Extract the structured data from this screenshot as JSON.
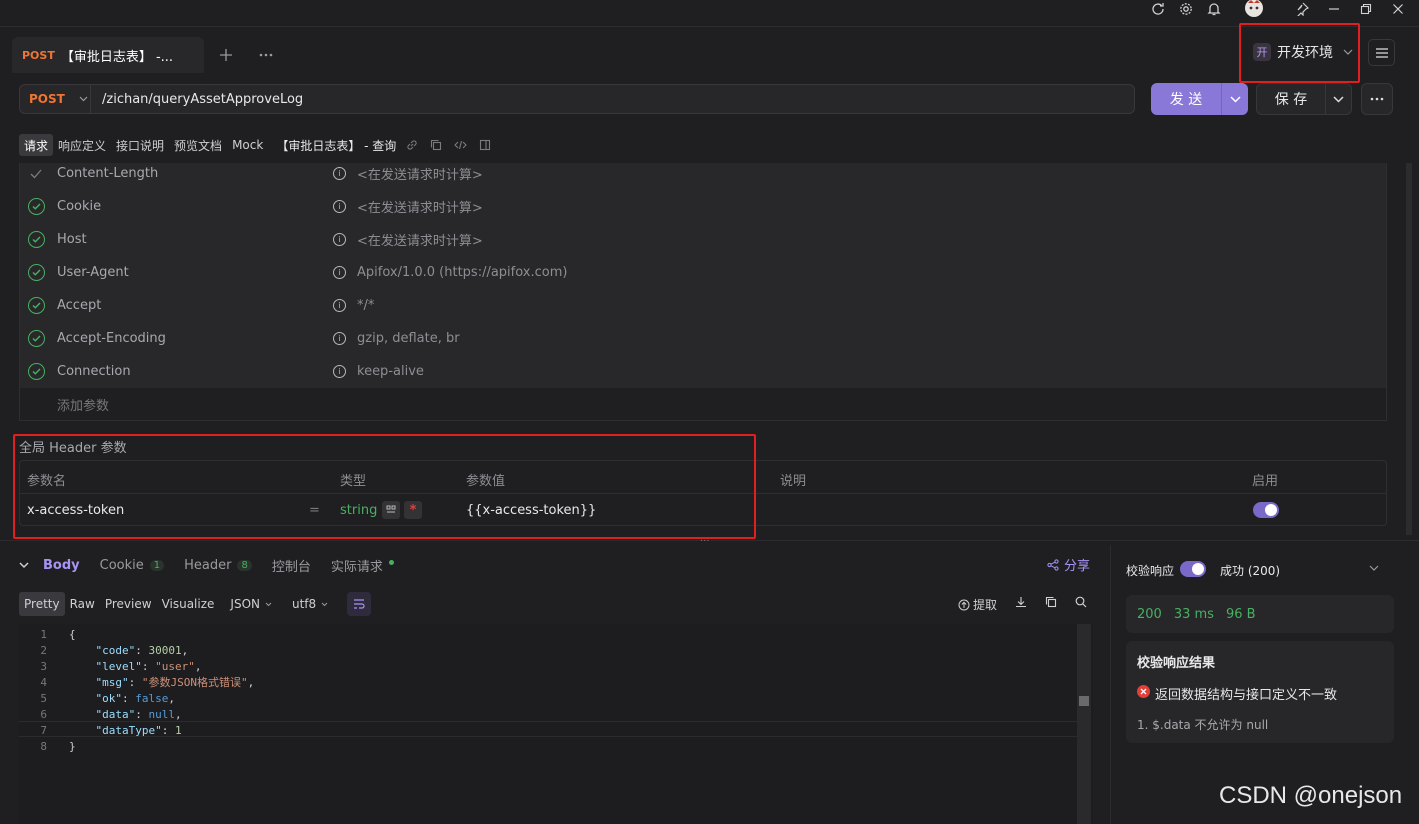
{
  "tab": {
    "method": "POST",
    "title": "【审批日志表】 -..."
  },
  "env": {
    "badge": "开",
    "name": "开发环境"
  },
  "request": {
    "method": "POST",
    "url": "/zichan/queryAssetApproveLog",
    "send_label": "发 送",
    "save_label": "保 存"
  },
  "subtabs": [
    "请求",
    "响应定义",
    "接口说明",
    "预览文档",
    "Mock"
  ],
  "subtab_active": "请求",
  "api_name": "【审批日志表】 - 查询",
  "headers": [
    {
      "name": "Content-Length",
      "value": "<在发送请求时计算>"
    },
    {
      "name": "Cookie",
      "value": "<在发送请求时计算>"
    },
    {
      "name": "Host",
      "value": "<在发送请求时计算>"
    },
    {
      "name": "User-Agent",
      "value": "Apifox/1.0.0 (https://apifox.com)"
    },
    {
      "name": "Accept",
      "value": "*/*"
    },
    {
      "name": "Accept-Encoding",
      "value": "gzip, deflate, br"
    },
    {
      "name": "Connection",
      "value": "keep-alive"
    }
  ],
  "add_param": "添加参数",
  "global_header": {
    "title": "全局 Header 参数",
    "columns": {
      "name": "参数名",
      "type": "类型",
      "value": "参数值",
      "desc": "说明",
      "enabled": "启用"
    },
    "row": {
      "name": "x-access-token",
      "eq": "=",
      "type": "string",
      "required": "*",
      "value": "{{x-access-token}}",
      "enabled": true
    }
  },
  "response": {
    "tabs": [
      {
        "label": "Body"
      },
      {
        "label": "Cookie",
        "count": "1"
      },
      {
        "label": "Header",
        "count": "8"
      },
      {
        "label": "控制台"
      },
      {
        "label": "实际请求"
      }
    ],
    "share": "分享",
    "formats": [
      "Pretty",
      "Raw",
      "Preview",
      "Visualize"
    ],
    "format_active": "Pretty",
    "lang": "JSON",
    "encoding": "utf8",
    "extract": "提取",
    "code_lines": [
      {
        "n": "1",
        "parts": [
          [
            "p",
            "{"
          ]
        ]
      },
      {
        "n": "2",
        "parts": [
          [
            "p",
            "    "
          ],
          [
            "k",
            "\"code\""
          ],
          [
            "p",
            ": "
          ],
          [
            "n",
            "30001"
          ],
          [
            "p",
            ","
          ]
        ]
      },
      {
        "n": "3",
        "parts": [
          [
            "p",
            "    "
          ],
          [
            "k",
            "\"level\""
          ],
          [
            "p",
            ": "
          ],
          [
            "s",
            "\"user\""
          ],
          [
            "p",
            ","
          ]
        ]
      },
      {
        "n": "4",
        "parts": [
          [
            "p",
            "    "
          ],
          [
            "k",
            "\"msg\""
          ],
          [
            "p",
            ": "
          ],
          [
            "s",
            "\"参数JSON格式错误\""
          ],
          [
            "p",
            ","
          ]
        ]
      },
      {
        "n": "5",
        "parts": [
          [
            "p",
            "    "
          ],
          [
            "k",
            "\"ok\""
          ],
          [
            "p",
            ": "
          ],
          [
            "b",
            "false"
          ],
          [
            "p",
            ","
          ]
        ]
      },
      {
        "n": "6",
        "parts": [
          [
            "p",
            "    "
          ],
          [
            "k",
            "\"data\""
          ],
          [
            "p",
            ": "
          ],
          [
            "b",
            "null"
          ],
          [
            "p",
            ","
          ]
        ]
      },
      {
        "n": "7",
        "parts": [
          [
            "p",
            "    "
          ],
          [
            "k",
            "\"dataType\""
          ],
          [
            "p",
            ": "
          ],
          [
            "n",
            "1"
          ]
        ]
      },
      {
        "n": "8",
        "parts": [
          [
            "p",
            "}"
          ]
        ]
      }
    ]
  },
  "validation": {
    "toggle_label": "校验响应",
    "status": "成功 (200)",
    "code": "200",
    "time": "33 ms",
    "size": "96 B",
    "result_title": "校验响应结果",
    "error": "返回数据结构与接口定义不一致",
    "detail": "1. $.data 不允许为 null"
  },
  "watermark": "CSDN @onejson",
  "colors": {
    "accent": "#8a78d8",
    "method": "#f07533",
    "ok": "#48b060",
    "error": "#e0403a",
    "highlight": "#e02020"
  }
}
